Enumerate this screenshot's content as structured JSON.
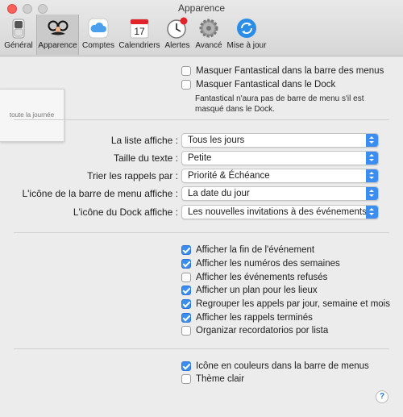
{
  "window": {
    "title": "Apparence"
  },
  "toolbar": {
    "items": [
      {
        "label": "Général",
        "icon": "switch-icon"
      },
      {
        "label": "Apparence",
        "icon": "disguise-mask-icon",
        "active": true
      },
      {
        "label": "Comptes",
        "icon": "cloud-icon"
      },
      {
        "label": "Calendriers",
        "icon": "calendar-icon",
        "day": "17"
      },
      {
        "label": "Alertes",
        "icon": "alarm-clock-icon"
      },
      {
        "label": "Avancé",
        "icon": "gear-icon"
      },
      {
        "label": "Mise à jour",
        "icon": "sync-icon"
      }
    ]
  },
  "top_options": {
    "hide_menubar": {
      "label": "Masquer Fantastical dans la barre des menus",
      "checked": false
    },
    "hide_dock": {
      "label": "Masquer Fantastical dans le Dock",
      "checked": false
    },
    "note": "Fantastical n'aura pas de barre de menu s'il est masqué dans le Dock."
  },
  "preview": {
    "label": "toute la journée"
  },
  "settings": [
    {
      "label": "La liste affiche :",
      "value": "Tous les jours"
    },
    {
      "label": "Taille du texte :",
      "value": "Petite"
    },
    {
      "label": "Trier les rappels par :",
      "value": "Priorité & Échéance"
    },
    {
      "label": "L'icône de la barre de menu affiche :",
      "value": "La date du jour"
    },
    {
      "label": "L'icône du Dock affiche :",
      "value": "Les nouvelles invitations à des événements"
    }
  ],
  "display_options": [
    {
      "label": "Afficher la fin de l'événement",
      "checked": true
    },
    {
      "label": "Afficher les numéros des semaines",
      "checked": true
    },
    {
      "label": "Afficher les événements refusés",
      "checked": false
    },
    {
      "label": "Afficher un plan pour les lieux",
      "checked": true
    },
    {
      "label": "Regrouper les appels par jour, semaine et mois",
      "checked": true
    },
    {
      "label": "Afficher les rappels terminés",
      "checked": true
    },
    {
      "label": "Organizar recordatorios por lista",
      "checked": false
    }
  ],
  "icon_options": [
    {
      "label": "Icône en couleurs dans la barre de menus",
      "checked": true
    },
    {
      "label": "Thème clair",
      "checked": false
    }
  ],
  "help": {
    "label": "?"
  },
  "colors": {
    "accent": "#3b8ef0",
    "close": "#fc605c",
    "badge": "#e0242a"
  }
}
